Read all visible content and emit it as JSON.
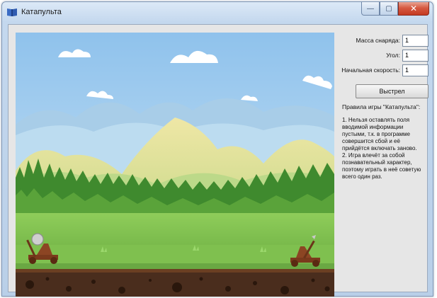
{
  "window": {
    "title": "Катапульта",
    "buttons": {
      "minimize": "—",
      "maximize": "▢",
      "close": "✕"
    }
  },
  "form": {
    "mass_label": "Масса снаряда:",
    "mass_value": "1",
    "angle_label": "Угол:",
    "angle_value": "1",
    "speed_label": "Начальная скорость:",
    "speed_value": "1",
    "shoot_button": "Выстрел"
  },
  "rules": {
    "title": "Правила игры \"Катапульта\":",
    "text": "1. Нельзя оставлять поля вводимой информации пустыми, т.к. в программе совершится сбой и её прийдётся включать заново.\n2. Игра влечёт за собой познавательный характер, поэтому играть в неё советую всего один раз."
  },
  "icons": {
    "app": "book-icon",
    "left_catapult": "catapult-icon",
    "right_catapult": "catapult-icon",
    "projectile": "stone-ball-icon"
  },
  "colors": {
    "sky": "#a9d2f2",
    "grass": "#76b84a",
    "soil": "#4a2d1d",
    "close_button": "#d65a42"
  }
}
